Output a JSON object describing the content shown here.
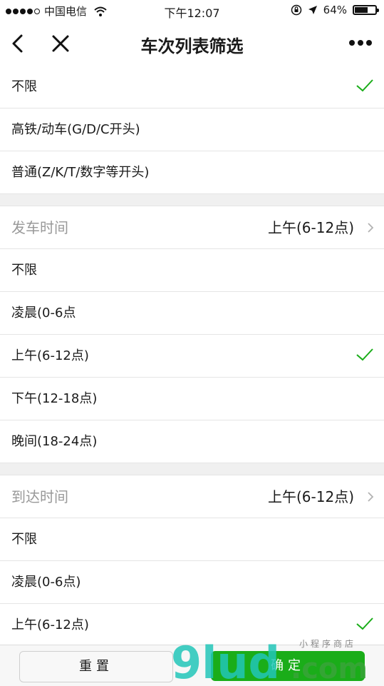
{
  "status": {
    "carrier": "中国电信",
    "time": "下午12:07",
    "battery": "64%",
    "battery_level": 0.64
  },
  "nav": {
    "title": "车次列表筛选"
  },
  "train_type": {
    "options": [
      "不限",
      "高铁/动车(G/D/C开头)",
      "普通(Z/K/T/数字等开头)"
    ],
    "selected": 0
  },
  "departure": {
    "title": "发车时间",
    "value": "上午(6-12点)",
    "options": [
      "不限",
      "凌晨(0-6点",
      "上午(6-12点)",
      "下午(12-18点)",
      "晚间(18-24点)"
    ],
    "selected": 2
  },
  "arrival": {
    "title": "到达时间",
    "value": "上午(6-12点)",
    "options": [
      "不限",
      "凌晨(0-6点)",
      "上午(6-12点)"
    ],
    "selected": 2
  },
  "buttons": {
    "reset": "重置",
    "confirm": "确定"
  },
  "watermark": {
    "text": "9ludi.com",
    "subtext": "小程序商店"
  },
  "colors": {
    "check": "#1aad19",
    "confirm_bg": "#1aad19",
    "watermark_teal": "#22c6b8",
    "watermark_green": "#3aa33a"
  }
}
